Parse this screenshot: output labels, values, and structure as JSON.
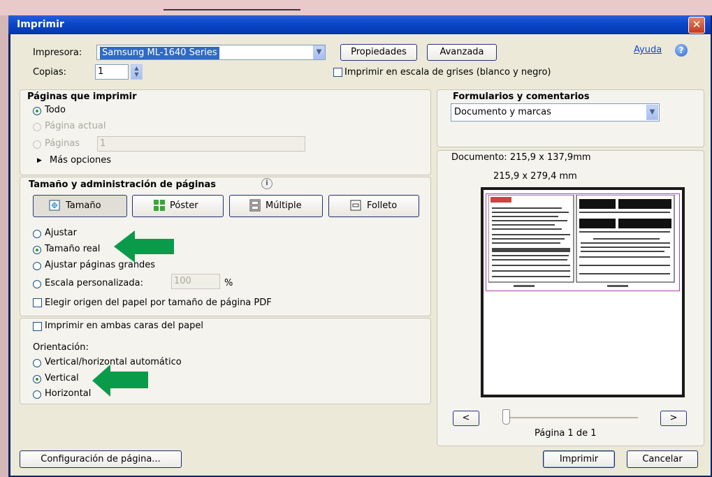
{
  "window": {
    "title": "Imprimir",
    "close_label": "✕"
  },
  "printer": {
    "label": "Impresora:",
    "selected": "Samsung ML-1640 Series",
    "properties_label": "Propiedades",
    "advanced_label": "Avanzada",
    "help_label": "Ayuda",
    "help_icon": "?"
  },
  "copies": {
    "label": "Copias:",
    "value": "1",
    "grayscale_label": "Imprimir en escala de grises (blanco y negro)",
    "grayscale_checked": false
  },
  "pages_to_print": {
    "title": "Páginas que imprimir",
    "options": [
      {
        "label": "Todo",
        "selected": true,
        "enabled": true
      },
      {
        "label": "Página actual",
        "selected": false,
        "enabled": false
      },
      {
        "label": "Páginas",
        "selected": false,
        "enabled": false
      }
    ],
    "pages_value": "1",
    "more_options_label": "Más opciones"
  },
  "page_sizing": {
    "title": "Tamaño y administración de páginas",
    "info_icon": "i",
    "tabs": [
      {
        "label": "Tamaño",
        "active": true
      },
      {
        "label": "Póster",
        "active": false
      },
      {
        "label": "Múltiple",
        "active": false
      },
      {
        "label": "Folleto",
        "active": false
      }
    ],
    "options": [
      {
        "label": "Ajustar",
        "selected": false
      },
      {
        "label": "Tamaño real",
        "selected": true
      },
      {
        "label": "Ajustar páginas grandes",
        "selected": false
      },
      {
        "label": "Escala personalizada:",
        "selected": false
      }
    ],
    "scale_value": "100",
    "scale_unit": "%",
    "paper_source_label": "Elegir origen del papel por tamaño de página PDF",
    "paper_source_checked": false
  },
  "duplex": {
    "label": "Imprimir en ambas caras del papel",
    "checked": false
  },
  "orientation": {
    "title": "Orientación:",
    "options": [
      {
        "label": "Vertical/horizontal automático",
        "selected": false
      },
      {
        "label": "Vertical",
        "selected": true
      },
      {
        "label": "Horizontal",
        "selected": false
      }
    ]
  },
  "comments": {
    "title": "Formularios y comentarios",
    "selected": "Documento y marcas"
  },
  "preview": {
    "document_size": "Documento: 215,9 x 137,9mm",
    "paper_size": "215,9 x 279,4 mm",
    "prev_label": "<",
    "next_label": ">",
    "page_indicator": "Página 1 de 1"
  },
  "footer": {
    "page_setup_label": "Configuración de página...",
    "print_label": "Imprimir",
    "cancel_label": "Cancelar"
  },
  "colors": {
    "title_bar": "#0a47c9",
    "dialog_bg": "#ece9d8",
    "annotation_arrow": "#0a9b4a"
  }
}
